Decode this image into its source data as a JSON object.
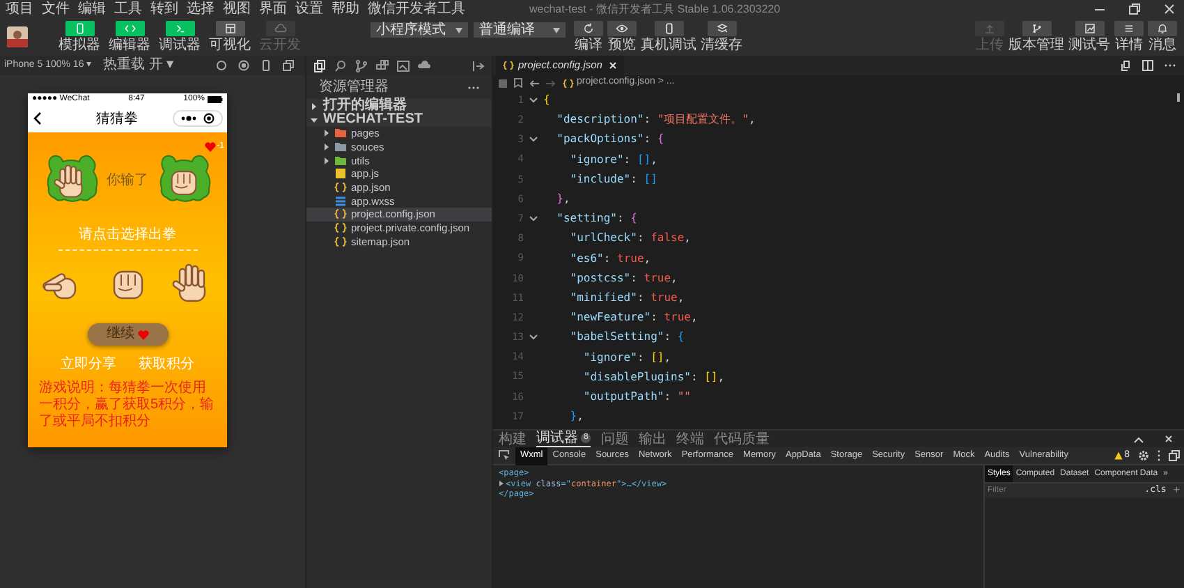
{
  "menu_bar": {
    "items": [
      "项目",
      "文件",
      "编辑",
      "工具",
      "转到",
      "选择",
      "视图",
      "界面",
      "设置",
      "帮助",
      "微信开发者工具"
    ],
    "title": "wechat-test - 微信开发者工具 Stable 1.06.2303220"
  },
  "toolbar": {
    "mode_buttons": [
      {
        "label": "模拟器",
        "kind": "phone",
        "on": true,
        "disabled": false
      },
      {
        "label": "编辑器",
        "kind": "code",
        "on": true,
        "disabled": false
      },
      {
        "label": "调试器",
        "kind": "debug",
        "on": true,
        "disabled": false
      },
      {
        "label": "可视化",
        "kind": "grid",
        "on": false,
        "disabled": false
      },
      {
        "label": "云开发",
        "kind": "cloud",
        "on": false,
        "disabled": true
      }
    ],
    "mode_select": "小程序模式",
    "compile_select": "普通编译",
    "actions": [
      {
        "label": "编译",
        "kind": "refresh"
      },
      {
        "label": "预览",
        "kind": "eye"
      },
      {
        "label": "真机调试",
        "kind": "phone"
      },
      {
        "label": "清缓存",
        "kind": "layers"
      }
    ],
    "right_buttons": [
      {
        "label": "上传",
        "kind": "upload",
        "disabled": true
      },
      {
        "label": "版本管理",
        "kind": "branch",
        "disabled": false
      },
      {
        "label": "测试号",
        "kind": "chart",
        "disabled": false
      },
      {
        "label": "详情",
        "kind": "list",
        "disabled": false
      },
      {
        "label": "消息",
        "kind": "bell",
        "disabled": false
      }
    ]
  },
  "simulator_bar": {
    "device": "iPhone 5 100% 16 ▾",
    "hot_reload": "热重载 开 ▾"
  },
  "phone": {
    "carrier": "●●●●● WeChat",
    "time": "8:47",
    "battery": "100%",
    "title": "猜猜拳",
    "lives": "-1",
    "player": {
      "kind": "paper"
    },
    "result": "你输了",
    "computer": {
      "kind": "rock"
    },
    "prompt": "请点击选择出拳",
    "choices": [
      {
        "kind": "scissors"
      },
      {
        "kind": "rock"
      },
      {
        "kind": "paper"
      }
    ],
    "continue": "继续",
    "links": [
      "立即分享",
      "获取积分"
    ],
    "rules": "游戏说明：每猜拳一次使用一积分，赢了获取5积分，输了或平局不扣积分"
  },
  "explorer": {
    "title": "资源管理器",
    "sections": [
      {
        "label": "打开的编辑器",
        "expanded": false
      },
      {
        "label": "WECHAT-TEST",
        "expanded": true,
        "children": [
          {
            "label": "pages",
            "kind": "folder",
            "color": "#e8623e",
            "expanded": false,
            "selected": false
          },
          {
            "label": "souces",
            "kind": "folder",
            "color": "#8a9aa6",
            "expanded": false,
            "selected": false
          },
          {
            "label": "utils",
            "kind": "folder",
            "color": "#6cb83a",
            "expanded": false,
            "selected": false
          },
          {
            "label": "app.js",
            "kind": "js",
            "selected": false
          },
          {
            "label": "app.json",
            "kind": "json",
            "selected": false
          },
          {
            "label": "app.wxss",
            "kind": "wxss",
            "selected": false
          },
          {
            "label": "project.config.json",
            "kind": "json",
            "selected": true
          },
          {
            "label": "project.private.config.json",
            "kind": "json",
            "selected": false
          },
          {
            "label": "sitemap.json",
            "kind": "json",
            "selected": false
          }
        ]
      }
    ]
  },
  "editor": {
    "tab": "project.config.json",
    "breadcrumb": "project.config.json > ...",
    "lines": [
      {
        "number": "1",
        "foldable": true,
        "tokens": [
          {
            "text": "{",
            "kind": "b1"
          }
        ]
      },
      {
        "number": "2",
        "foldable": false,
        "tokens": [
          {
            "text": "  \"description\"",
            "kind": "key"
          },
          {
            "text": ": ",
            "kind": "p"
          },
          {
            "text": "\"项目配置文件。\"",
            "kind": "str"
          },
          {
            "text": ",",
            "kind": "p"
          }
        ]
      },
      {
        "number": "3",
        "foldable": true,
        "tokens": [
          {
            "text": "  \"packOptions\"",
            "kind": "key"
          },
          {
            "text": ": ",
            "kind": "p"
          },
          {
            "text": "{",
            "kind": "b2"
          }
        ]
      },
      {
        "number": "4",
        "foldable": false,
        "tokens": [
          {
            "text": "    \"ignore\"",
            "kind": "key"
          },
          {
            "text": ": ",
            "kind": "p"
          },
          {
            "text": "[]",
            "kind": "b3"
          },
          {
            "text": ",",
            "kind": "p"
          }
        ]
      },
      {
        "number": "5",
        "foldable": false,
        "tokens": [
          {
            "text": "    \"include\"",
            "kind": "key"
          },
          {
            "text": ": ",
            "kind": "p"
          },
          {
            "text": "[]",
            "kind": "b3"
          }
        ]
      },
      {
        "number": "6",
        "foldable": false,
        "tokens": [
          {
            "text": "  }",
            "kind": "b2"
          },
          {
            "text": ",",
            "kind": "p"
          }
        ]
      },
      {
        "number": "7",
        "foldable": true,
        "tokens": [
          {
            "text": "  \"setting\"",
            "kind": "key"
          },
          {
            "text": ": ",
            "kind": "p"
          },
          {
            "text": "{",
            "kind": "b2"
          }
        ]
      },
      {
        "number": "8",
        "foldable": false,
        "tokens": [
          {
            "text": "    \"urlCheck\"",
            "kind": "key"
          },
          {
            "text": ": ",
            "kind": "p"
          },
          {
            "text": "false",
            "kind": "bool"
          },
          {
            "text": ",",
            "kind": "p"
          }
        ]
      },
      {
        "number": "9",
        "foldable": false,
        "tokens": [
          {
            "text": "    \"es6\"",
            "kind": "key"
          },
          {
            "text": ": ",
            "kind": "p"
          },
          {
            "text": "true",
            "kind": "bool"
          },
          {
            "text": ",",
            "kind": "p"
          }
        ]
      },
      {
        "number": "10",
        "foldable": false,
        "tokens": [
          {
            "text": "    \"postcss\"",
            "kind": "key"
          },
          {
            "text": ": ",
            "kind": "p"
          },
          {
            "text": "true",
            "kind": "bool"
          },
          {
            "text": ",",
            "kind": "p"
          }
        ]
      },
      {
        "number": "11",
        "foldable": false,
        "tokens": [
          {
            "text": "    \"minified\"",
            "kind": "key"
          },
          {
            "text": ": ",
            "kind": "p"
          },
          {
            "text": "true",
            "kind": "bool"
          },
          {
            "text": ",",
            "kind": "p"
          }
        ]
      },
      {
        "number": "12",
        "foldable": false,
        "tokens": [
          {
            "text": "    \"newFeature\"",
            "kind": "key"
          },
          {
            "text": ": ",
            "kind": "p"
          },
          {
            "text": "true",
            "kind": "bool"
          },
          {
            "text": ",",
            "kind": "p"
          }
        ]
      },
      {
        "number": "13",
        "foldable": true,
        "tokens": [
          {
            "text": "    \"babelSetting\"",
            "kind": "key"
          },
          {
            "text": ": ",
            "kind": "p"
          },
          {
            "text": "{",
            "kind": "b3"
          }
        ]
      },
      {
        "number": "14",
        "foldable": false,
        "tokens": [
          {
            "text": "      \"ignore\"",
            "kind": "key"
          },
          {
            "text": ": ",
            "kind": "p"
          },
          {
            "text": "[]",
            "kind": "b1"
          },
          {
            "text": ",",
            "kind": "p"
          }
        ]
      },
      {
        "number": "15",
        "foldable": false,
        "tokens": [
          {
            "text": "      \"disablePlugins\"",
            "kind": "key"
          },
          {
            "text": ": ",
            "kind": "p"
          },
          {
            "text": "[]",
            "kind": "b1"
          },
          {
            "text": ",",
            "kind": "p"
          }
        ]
      },
      {
        "number": "16",
        "foldable": false,
        "tokens": [
          {
            "text": "      \"outputPath\"",
            "kind": "key"
          },
          {
            "text": ": ",
            "kind": "p"
          },
          {
            "text": "\"\"",
            "kind": "str"
          }
        ]
      },
      {
        "number": "17",
        "foldable": false,
        "tokens": [
          {
            "text": "    }",
            "kind": "b3"
          },
          {
            "text": ",",
            "kind": "p"
          }
        ]
      }
    ]
  },
  "bottom_panel": {
    "tabs": [
      {
        "label": "构建",
        "selected": false
      },
      {
        "label": "调试器",
        "selected": true,
        "badge": "8"
      },
      {
        "label": "问题",
        "selected": false
      },
      {
        "label": "输出",
        "selected": false
      },
      {
        "label": "终端",
        "selected": false
      },
      {
        "label": "代码质量",
        "selected": false
      }
    ],
    "devtools_tabs": [
      {
        "label": "Wxml",
        "selected": true
      },
      {
        "label": "Console",
        "selected": false
      },
      {
        "label": "Sources",
        "selected": false
      },
      {
        "label": "Network",
        "selected": false
      },
      {
        "label": "Performance",
        "selected": false
      },
      {
        "label": "Memory",
        "selected": false
      },
      {
        "label": "AppData",
        "selected": false
      },
      {
        "label": "Storage",
        "selected": false
      },
      {
        "label": "Security",
        "selected": false
      },
      {
        "label": "Sensor",
        "selected": false
      },
      {
        "label": "Mock",
        "selected": false
      },
      {
        "label": "Audits",
        "selected": false
      },
      {
        "label": "Vulnerability",
        "selected": false
      }
    ],
    "warnings": "8",
    "wxml": [
      {
        "kind": "plain",
        "tokens": [
          {
            "text": "<page>",
            "kind": "tag"
          }
        ]
      },
      {
        "kind": "collapsed",
        "tokens": [
          {
            "text": "<view ",
            "kind": "tag"
          },
          {
            "text": "class",
            "kind": "attr"
          },
          {
            "text": "=\"",
            "kind": "tag"
          },
          {
            "text": "container",
            "kind": "value"
          },
          {
            "text": "\">…</view>",
            "kind": "tag"
          }
        ]
      },
      {
        "kind": "plain",
        "tokens": [
          {
            "text": "</page>",
            "kind": "tag"
          }
        ]
      }
    ],
    "styles_tabs": [
      {
        "label": "Styles",
        "selected": true
      },
      {
        "label": "Computed",
        "selected": false
      },
      {
        "label": "Dataset",
        "selected": false
      },
      {
        "label": "Component Data",
        "selected": false
      },
      {
        "label": "»",
        "selected": false
      }
    ],
    "filter_placeholder": "Filter",
    "cls": ".cls",
    "add": "+"
  }
}
